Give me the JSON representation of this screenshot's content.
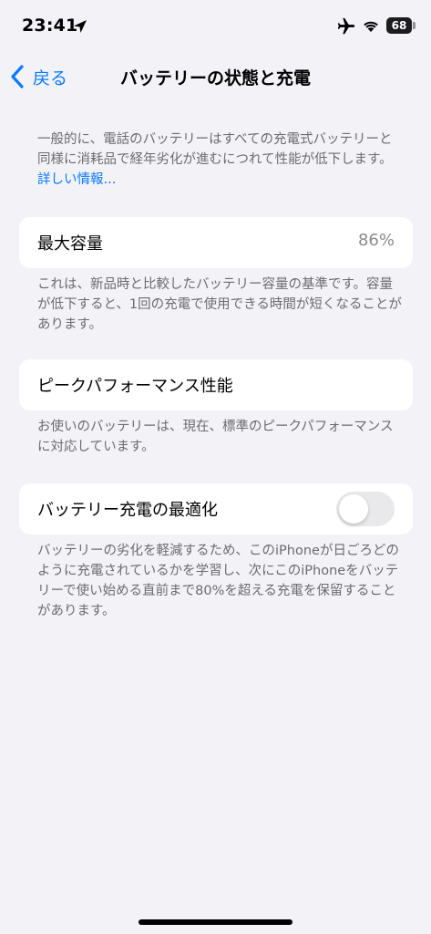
{
  "status_bar": {
    "time": "23:41",
    "battery_level": "68"
  },
  "nav": {
    "back_label": "戻る",
    "title": "バッテリーの状態と充電"
  },
  "intro": {
    "text": "一般的に、電話のバッテリーはすべての充電式バッテリーと同様に消耗品で経年劣化が進むにつれて性能が低下します。",
    "link": "詳しい情報..."
  },
  "max_capacity": {
    "label": "最大容量",
    "value": "86%",
    "footnote": "これは、新品時と比較したバッテリー容量の基準です。容量が低下すると、1回の充電で使用できる時間が短くなることがあります。"
  },
  "peak_performance": {
    "label": "ピークパフォーマンス性能",
    "footnote": "お使いのバッテリーは、現在、標準のピークパフォーマンスに対応しています。"
  },
  "optimized_charging": {
    "label": "バッテリー充電の最適化",
    "enabled": false,
    "footnote": "バッテリーの劣化を軽減するため、このiPhoneが日ごろどのように充電されているかを学習し、次にこのiPhoneをバッテリーで使い始める直前まで80%を超える充電を保留することがあります。"
  },
  "colors": {
    "accent": "#0a7aff",
    "background": "#f2f2f7",
    "secondary_text": "#6c6c70"
  },
  "icons": [
    "location-icon",
    "airplane-icon",
    "wifi-icon",
    "battery-icon",
    "chevron-left-icon"
  ]
}
